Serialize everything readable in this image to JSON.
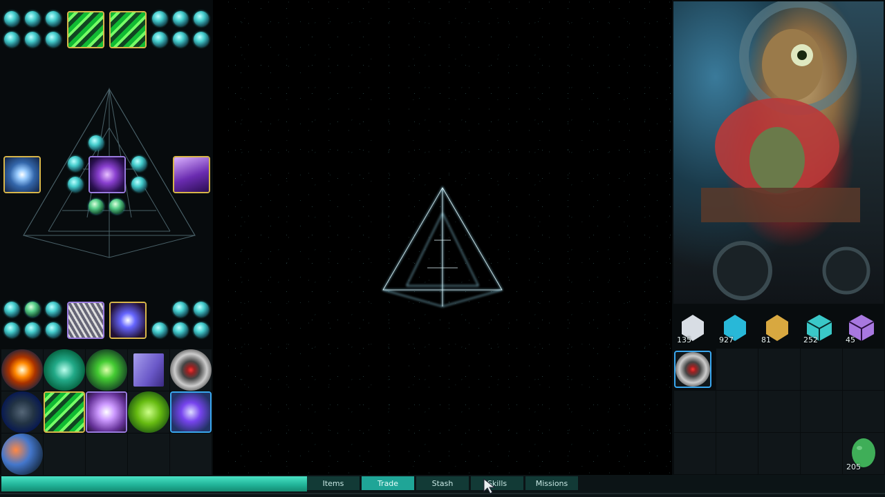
{
  "tabs": [
    {
      "label": "Items",
      "active": false
    },
    {
      "label": "Trade",
      "active": true
    },
    {
      "label": "Stash",
      "active": false
    },
    {
      "label": "Skills",
      "active": false
    },
    {
      "label": "Missions",
      "active": false
    }
  ],
  "progress": {
    "value": 0.345
  },
  "resources": [
    {
      "name": "crystal-white",
      "count": "135",
      "color": "#d8dde4"
    },
    {
      "name": "crystal-cyan",
      "count": "927",
      "color": "#28b8d8"
    },
    {
      "name": "crystal-gold",
      "count": "81",
      "color": "#d8a840"
    },
    {
      "name": "cube-tech",
      "count": "252",
      "color": "#3ac8c8"
    },
    {
      "name": "cube-violet",
      "count": "45",
      "color": "#a878e0"
    }
  ],
  "egg": {
    "count": "205",
    "color": "#3fae58"
  },
  "colors": {
    "accent": "#1fa597",
    "tab_bg": "#123a36",
    "gold_border": "#d8b64a",
    "violet_border": "#9a7be0",
    "blue_border": "#3aa8f0"
  }
}
